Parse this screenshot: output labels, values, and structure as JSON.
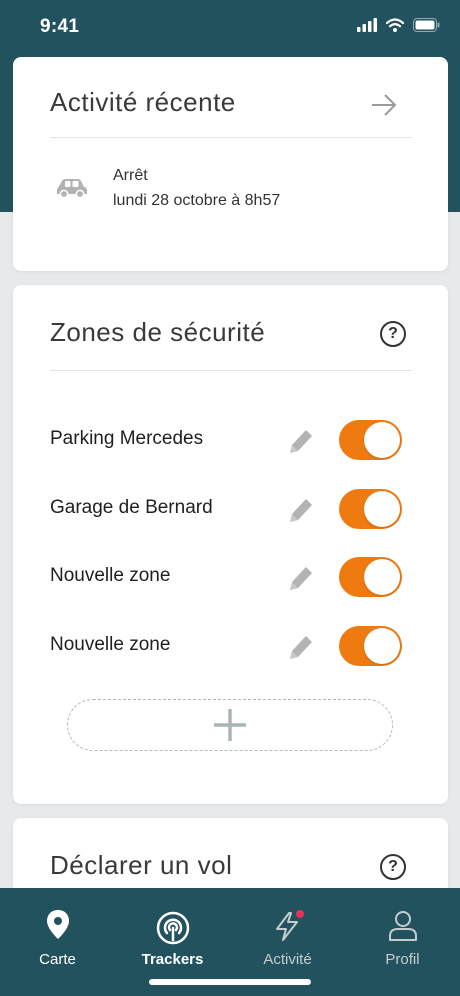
{
  "status_bar": {
    "time": "9:41",
    "icons": [
      "signal-icon",
      "wifi-icon",
      "battery-icon"
    ]
  },
  "recent_activity": {
    "title": "Activité récente",
    "arrow_icon": "arrow-right-icon",
    "item": {
      "icon": "car-icon",
      "status": "Arrêt",
      "datetime": "lundi 28 octobre à 8h57"
    }
  },
  "safety_zones": {
    "title": "Zones de sécurité",
    "help_symbol": "?",
    "zones": [
      {
        "name": "Parking Mercedes",
        "enabled": true
      },
      {
        "name": "Garage de Bernard",
        "enabled": true
      },
      {
        "name": "Nouvelle zone",
        "enabled": true
      },
      {
        "name": "Nouvelle zone",
        "enabled": true
      }
    ],
    "add_icon": "plus-icon"
  },
  "declare_theft": {
    "title": "Déclarer un vol",
    "help_symbol": "?"
  },
  "bottom_nav": {
    "items": [
      {
        "label": "Carte",
        "icon": "map-pin-icon",
        "active": false
      },
      {
        "label": "Trackers",
        "icon": "tracker-icon",
        "active": true
      },
      {
        "label": "Activité",
        "icon": "lightning-icon",
        "active": false,
        "badge": true
      },
      {
        "label": "Profil",
        "icon": "user-icon",
        "active": false
      }
    ]
  },
  "colors": {
    "primary": "#23525f",
    "accent": "#ee7a10",
    "background": "#e8e9ea",
    "badge": "#e8325a"
  }
}
